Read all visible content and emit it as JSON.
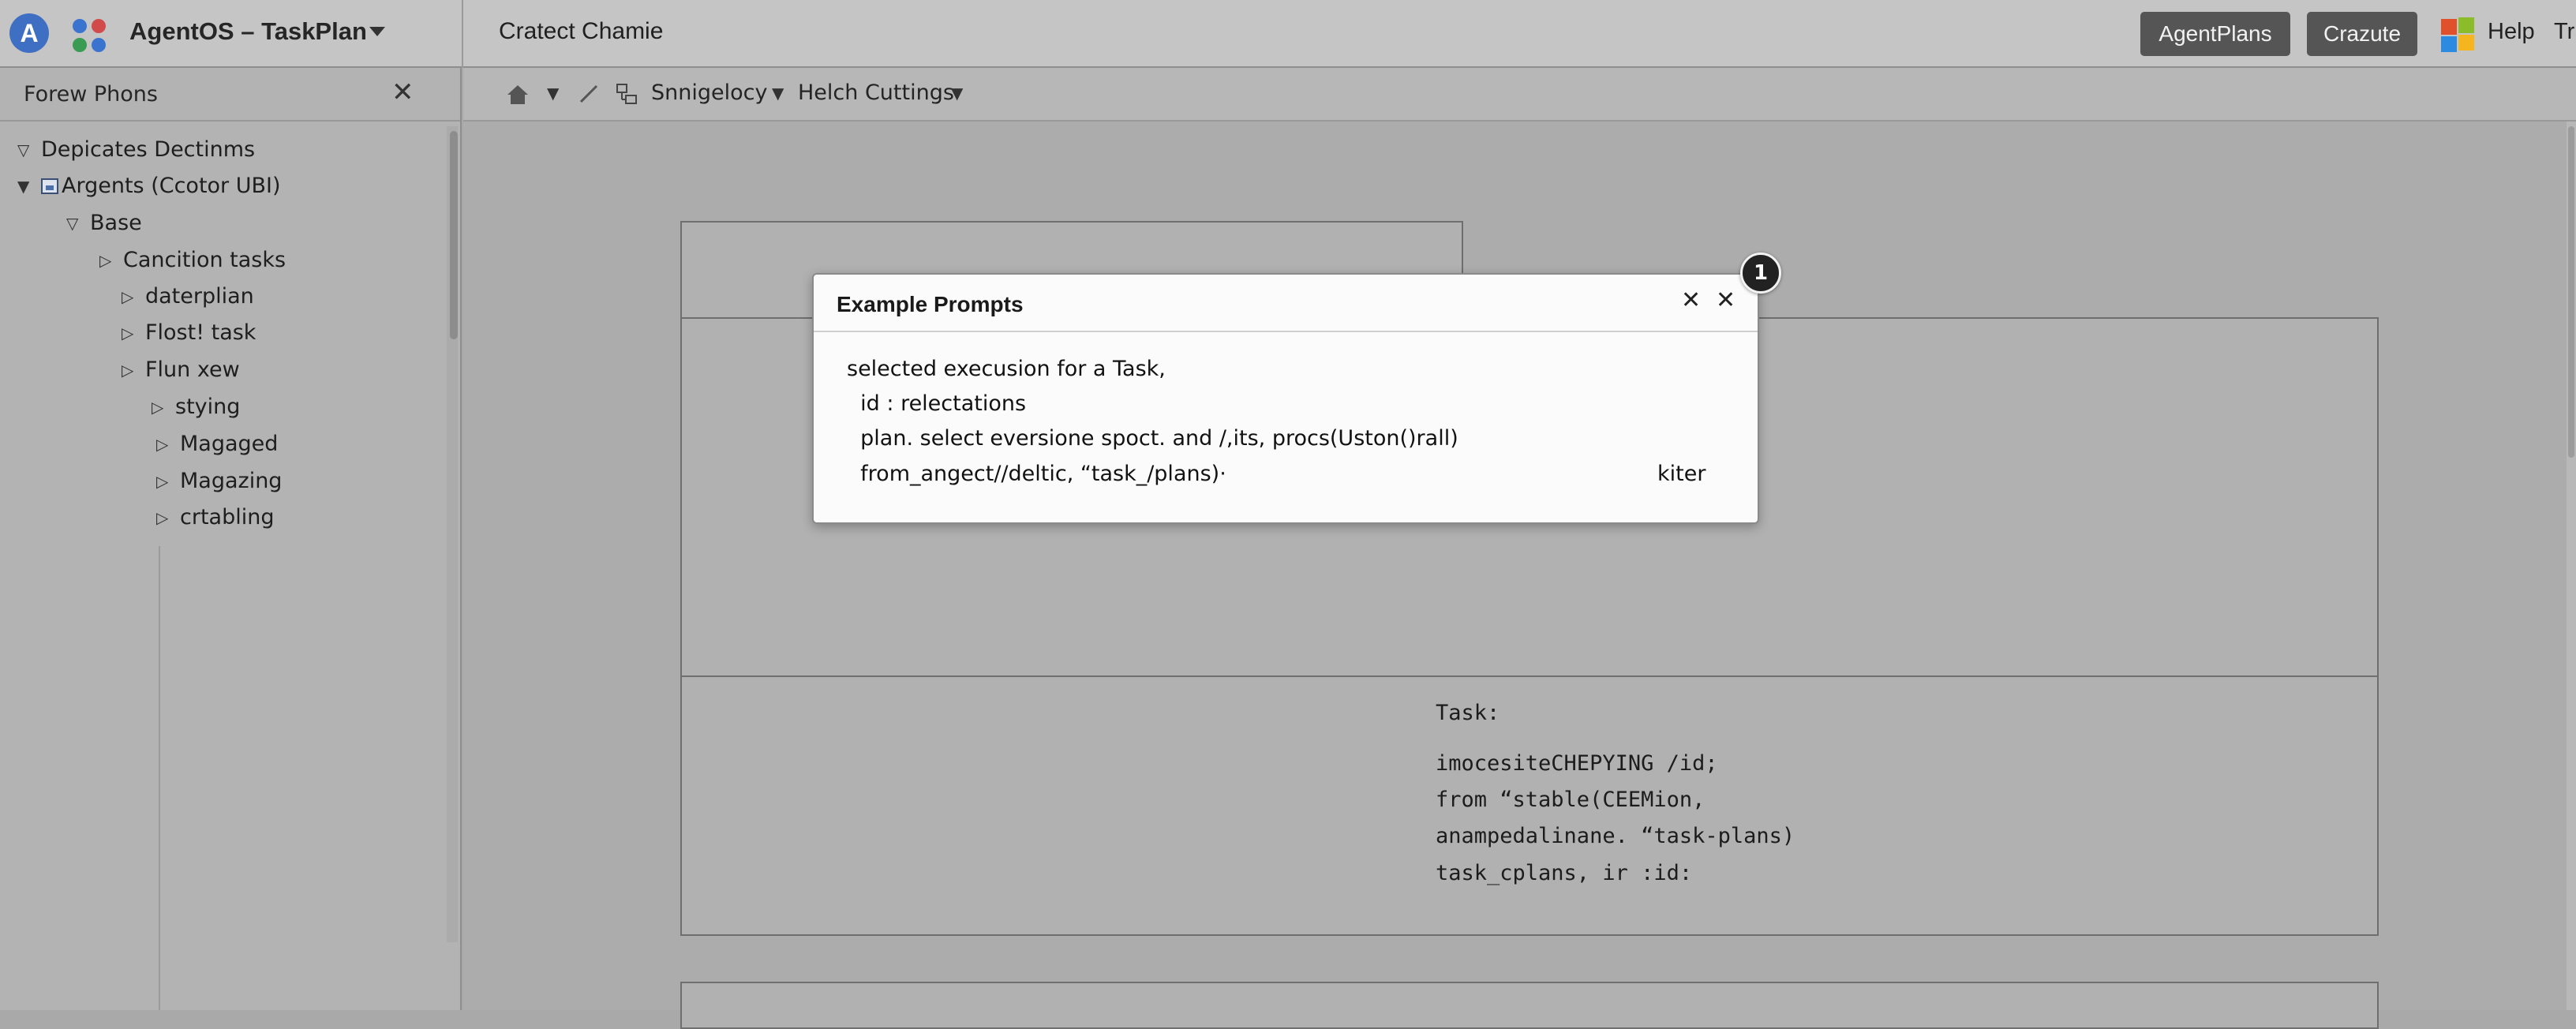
{
  "topbar": {
    "app_logo_letter": "A",
    "app_logo_icon": "agentos-logo-icon",
    "apps_icon": "apps-dots-icon",
    "app_title": "AgentOS – TaskPlan",
    "doc_title": "Cratect Chamie",
    "buttons": {
      "agentplans": "AgentPlans",
      "crazute": "Crazute"
    },
    "windows_icon": "windows-logo-icon",
    "help": "Help",
    "tr_cut": "Tr"
  },
  "left_panel": {
    "title": "Forew  Phons",
    "close_icon": "close-icon",
    "tree": [
      {
        "label": "Depicates Dectinms",
        "toggle": "▽"
      },
      {
        "label": "Argents (Ccotor UBI)",
        "toggle": "▼",
        "icon": "database-icon"
      },
      {
        "label": "Base",
        "toggle": "▽"
      },
      {
        "label": "Cancition tasks",
        "toggle": "▷"
      },
      {
        "label": "daterplian",
        "toggle": "▷"
      },
      {
        "label": "Flost! task",
        "toggle": "▷"
      },
      {
        "label": "Flun  xew",
        "toggle": "▷"
      },
      {
        "label": "stying",
        "toggle": "▷"
      },
      {
        "label": "Magaged",
        "toggle": "▷"
      },
      {
        "label": "Magazing",
        "toggle": "▷"
      },
      {
        "label": "crtabling",
        "toggle": "▷"
      }
    ]
  },
  "breadcrumb": {
    "home_icon": "home-icon",
    "edit_icon": "pencil-icon",
    "schema_icon": "schema-icon",
    "item1": "Snnigelocy",
    "item2": "Helch Cuttings"
  },
  "task_panel": {
    "heading": "Task:",
    "lines": [
      "imocesiteCHEPYING /id;",
      "from “stable(CEEMion,",
      "anampedalinane. “task-plans)",
      "task_cplans, ir :id:"
    ]
  },
  "dialog": {
    "title": "Example Prompts",
    "lines": [
      "selected execusion for a Task,",
      "  id : relectations",
      "  plan. select eversione spoct. and /,its, procs(Uston()rall)",
      "  from_angect//deltic, “task_/plans)·"
    ],
    "action_label": "kiter",
    "close_icons": [
      "close-icon",
      "close-icon"
    ],
    "badge": "1"
  },
  "colors": {
    "topbar_bg": "#c5c5c5",
    "canvas_bg": "#acacac",
    "button_dark": "#555555",
    "logo_blue": "#3f6fc2",
    "dialog_bg": "#fbfbfb"
  }
}
